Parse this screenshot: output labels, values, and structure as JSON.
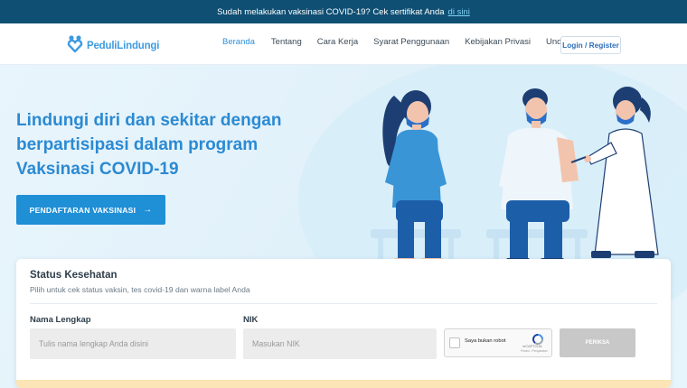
{
  "topbar": {
    "message": "Sudah melakukan vaksinasi COVID-19? Cek sertifikat Anda",
    "link": "di sini"
  },
  "brand": {
    "name": "PeduliLindungi",
    "logo_icon": "heart-people-logo",
    "color": "#3d9be0"
  },
  "nav": {
    "items": [
      "Beranda",
      "Tentang",
      "Cara Kerja",
      "Syarat Penggunaan",
      "Kebijakan Privasi",
      "Unduh"
    ],
    "active": "Beranda",
    "login": "Login / Register"
  },
  "hero": {
    "title_lines": [
      "Lindungi diri dan sekitar dengan",
      "berpartisipasi dalam program",
      "Vaksinasi COVID-19"
    ],
    "cta": "PENDAFTARAN VAKSINASI",
    "cta_icon": "arrow-right-icon"
  },
  "status": {
    "title": "Status Kesehatan",
    "subtitle": "Pilih untuk cek status vaksin, tes covid-19 dan warna label Anda",
    "name_label": "Nama Lengkap",
    "name_placeholder": "Tulis nama lengkap Anda disini",
    "nik_label": "NIK",
    "nik_placeholder": "Masukan NIK",
    "captcha_label": "Saya bukan robot",
    "captcha_brand": "reCAPTCHA",
    "captcha_terms": "Privasi - Persyaratan",
    "submit": "PERIKSA"
  },
  "colors": {
    "topbar": "#0f4f73",
    "primary": "#1f8fd6",
    "title": "#2b8ad2",
    "hero_bg": "#e6f4fb"
  }
}
